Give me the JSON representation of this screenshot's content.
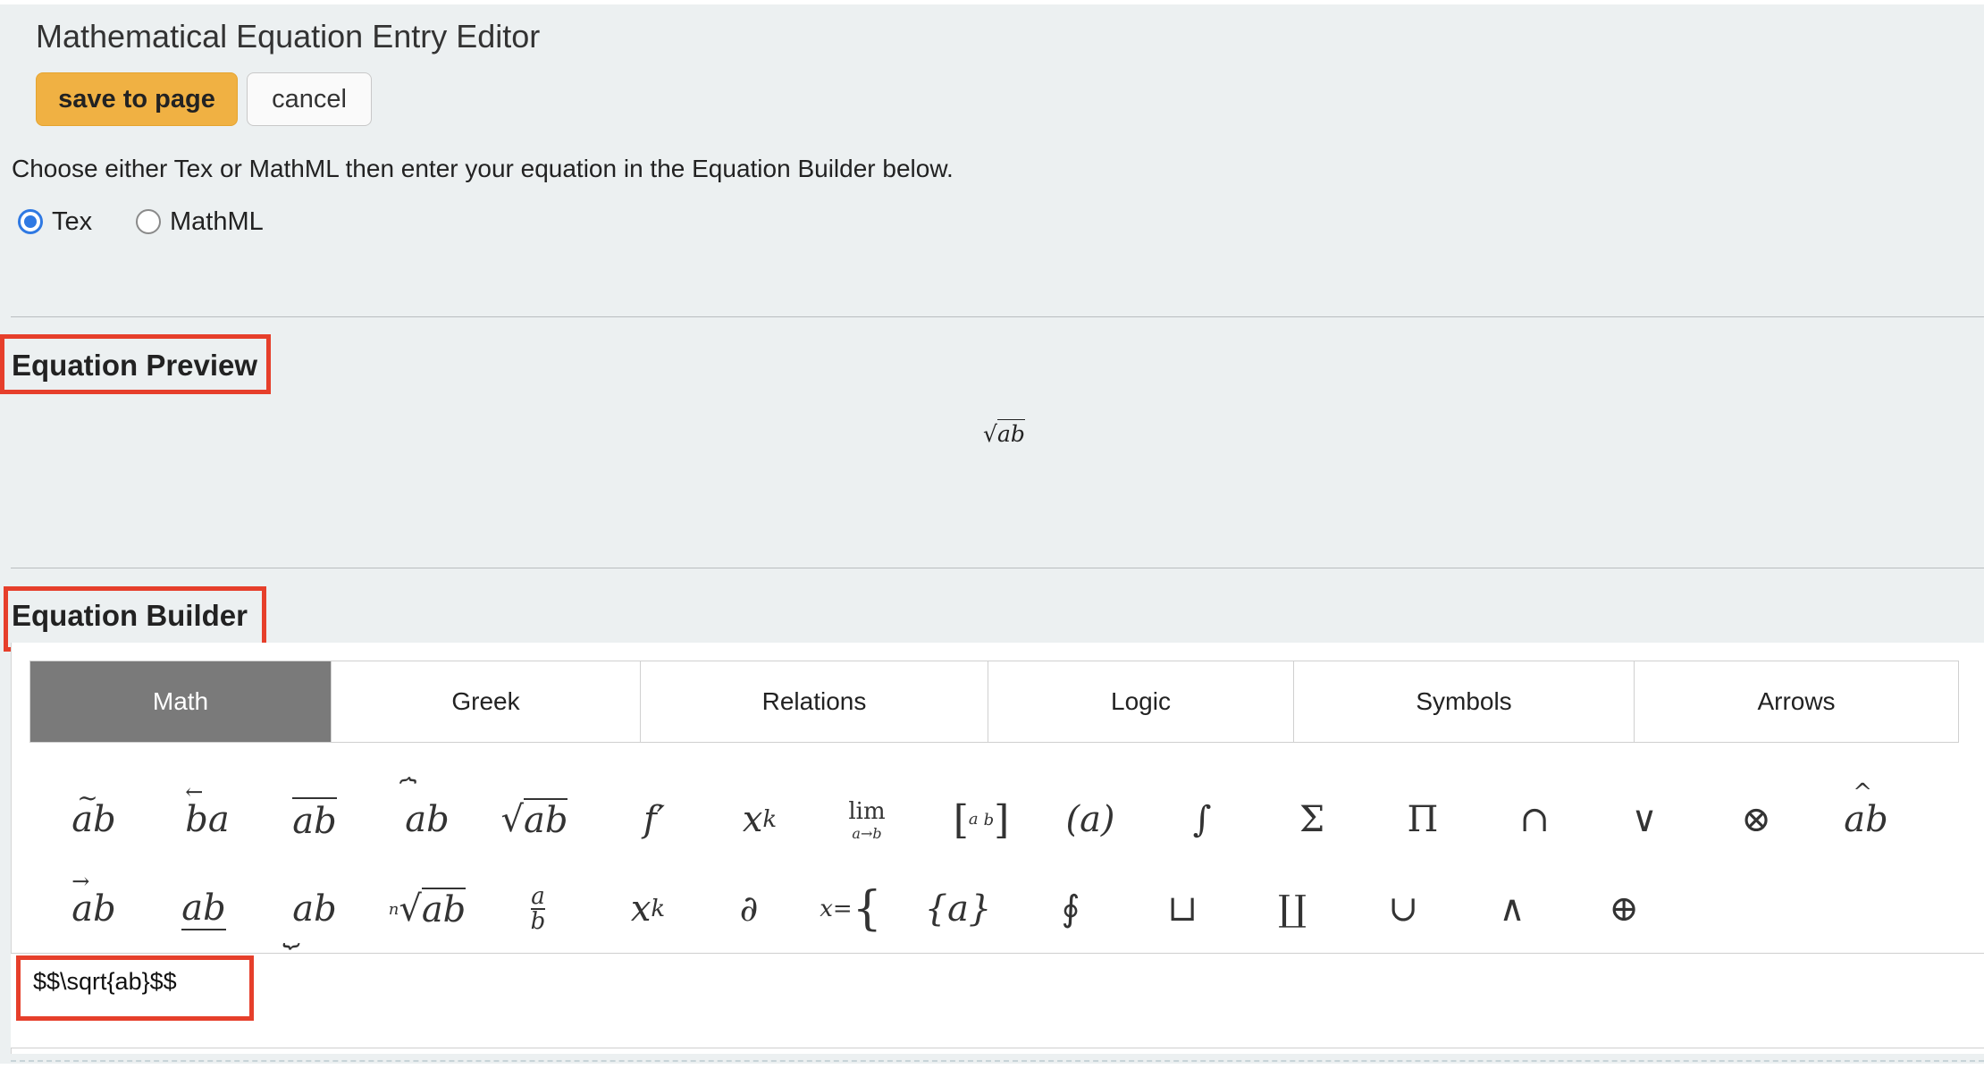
{
  "title": "Mathematical Equation Entry Editor",
  "buttons": {
    "save": "save to page",
    "cancel": "cancel"
  },
  "instructions": "Choose either Tex or MathML then enter your equation in the Equation Builder below.",
  "format": {
    "selected": "Tex",
    "options": [
      {
        "label": "Tex",
        "checked": true
      },
      {
        "label": "MathML",
        "checked": false
      }
    ]
  },
  "preview": {
    "heading": "Equation Preview",
    "radicand": "ab"
  },
  "builder": {
    "heading": "Equation Builder",
    "tabs": [
      {
        "label": "Math",
        "active": true
      },
      {
        "label": "Greek",
        "active": false
      },
      {
        "label": "Relations",
        "active": false
      },
      {
        "label": "Logic",
        "active": false
      },
      {
        "label": "Symbols",
        "active": false
      },
      {
        "label": "Arrows",
        "active": false
      }
    ],
    "row1": [
      "ab",
      "ba",
      "ab",
      "ab",
      "ab",
      "f′",
      "x",
      "lim",
      "a",
      "(a)",
      "∫",
      "Σ",
      "Π",
      "∩",
      "∨",
      "⊗",
      "ab"
    ],
    "row2": [
      "ab",
      "ab",
      "ab",
      "ab",
      "a",
      "x",
      "∂",
      "x",
      "{a}",
      "∮",
      "⊔",
      "∐",
      "∪",
      "∧",
      "⊕"
    ],
    "row1_sup": {
      "power": "k",
      "lim_sub": "a→b",
      "matrix_b": "b",
      "frac_den": "b",
      "root_index": "n",
      "sub_k": "k",
      "cases_eq": "="
    },
    "editor_value": "$$\\sqrt{ab}$$"
  },
  "colors": {
    "accent": "#f0b143",
    "radio": "#2f79e3",
    "highlight": "#e63f2b",
    "tab_active": "#7a7a7a"
  }
}
